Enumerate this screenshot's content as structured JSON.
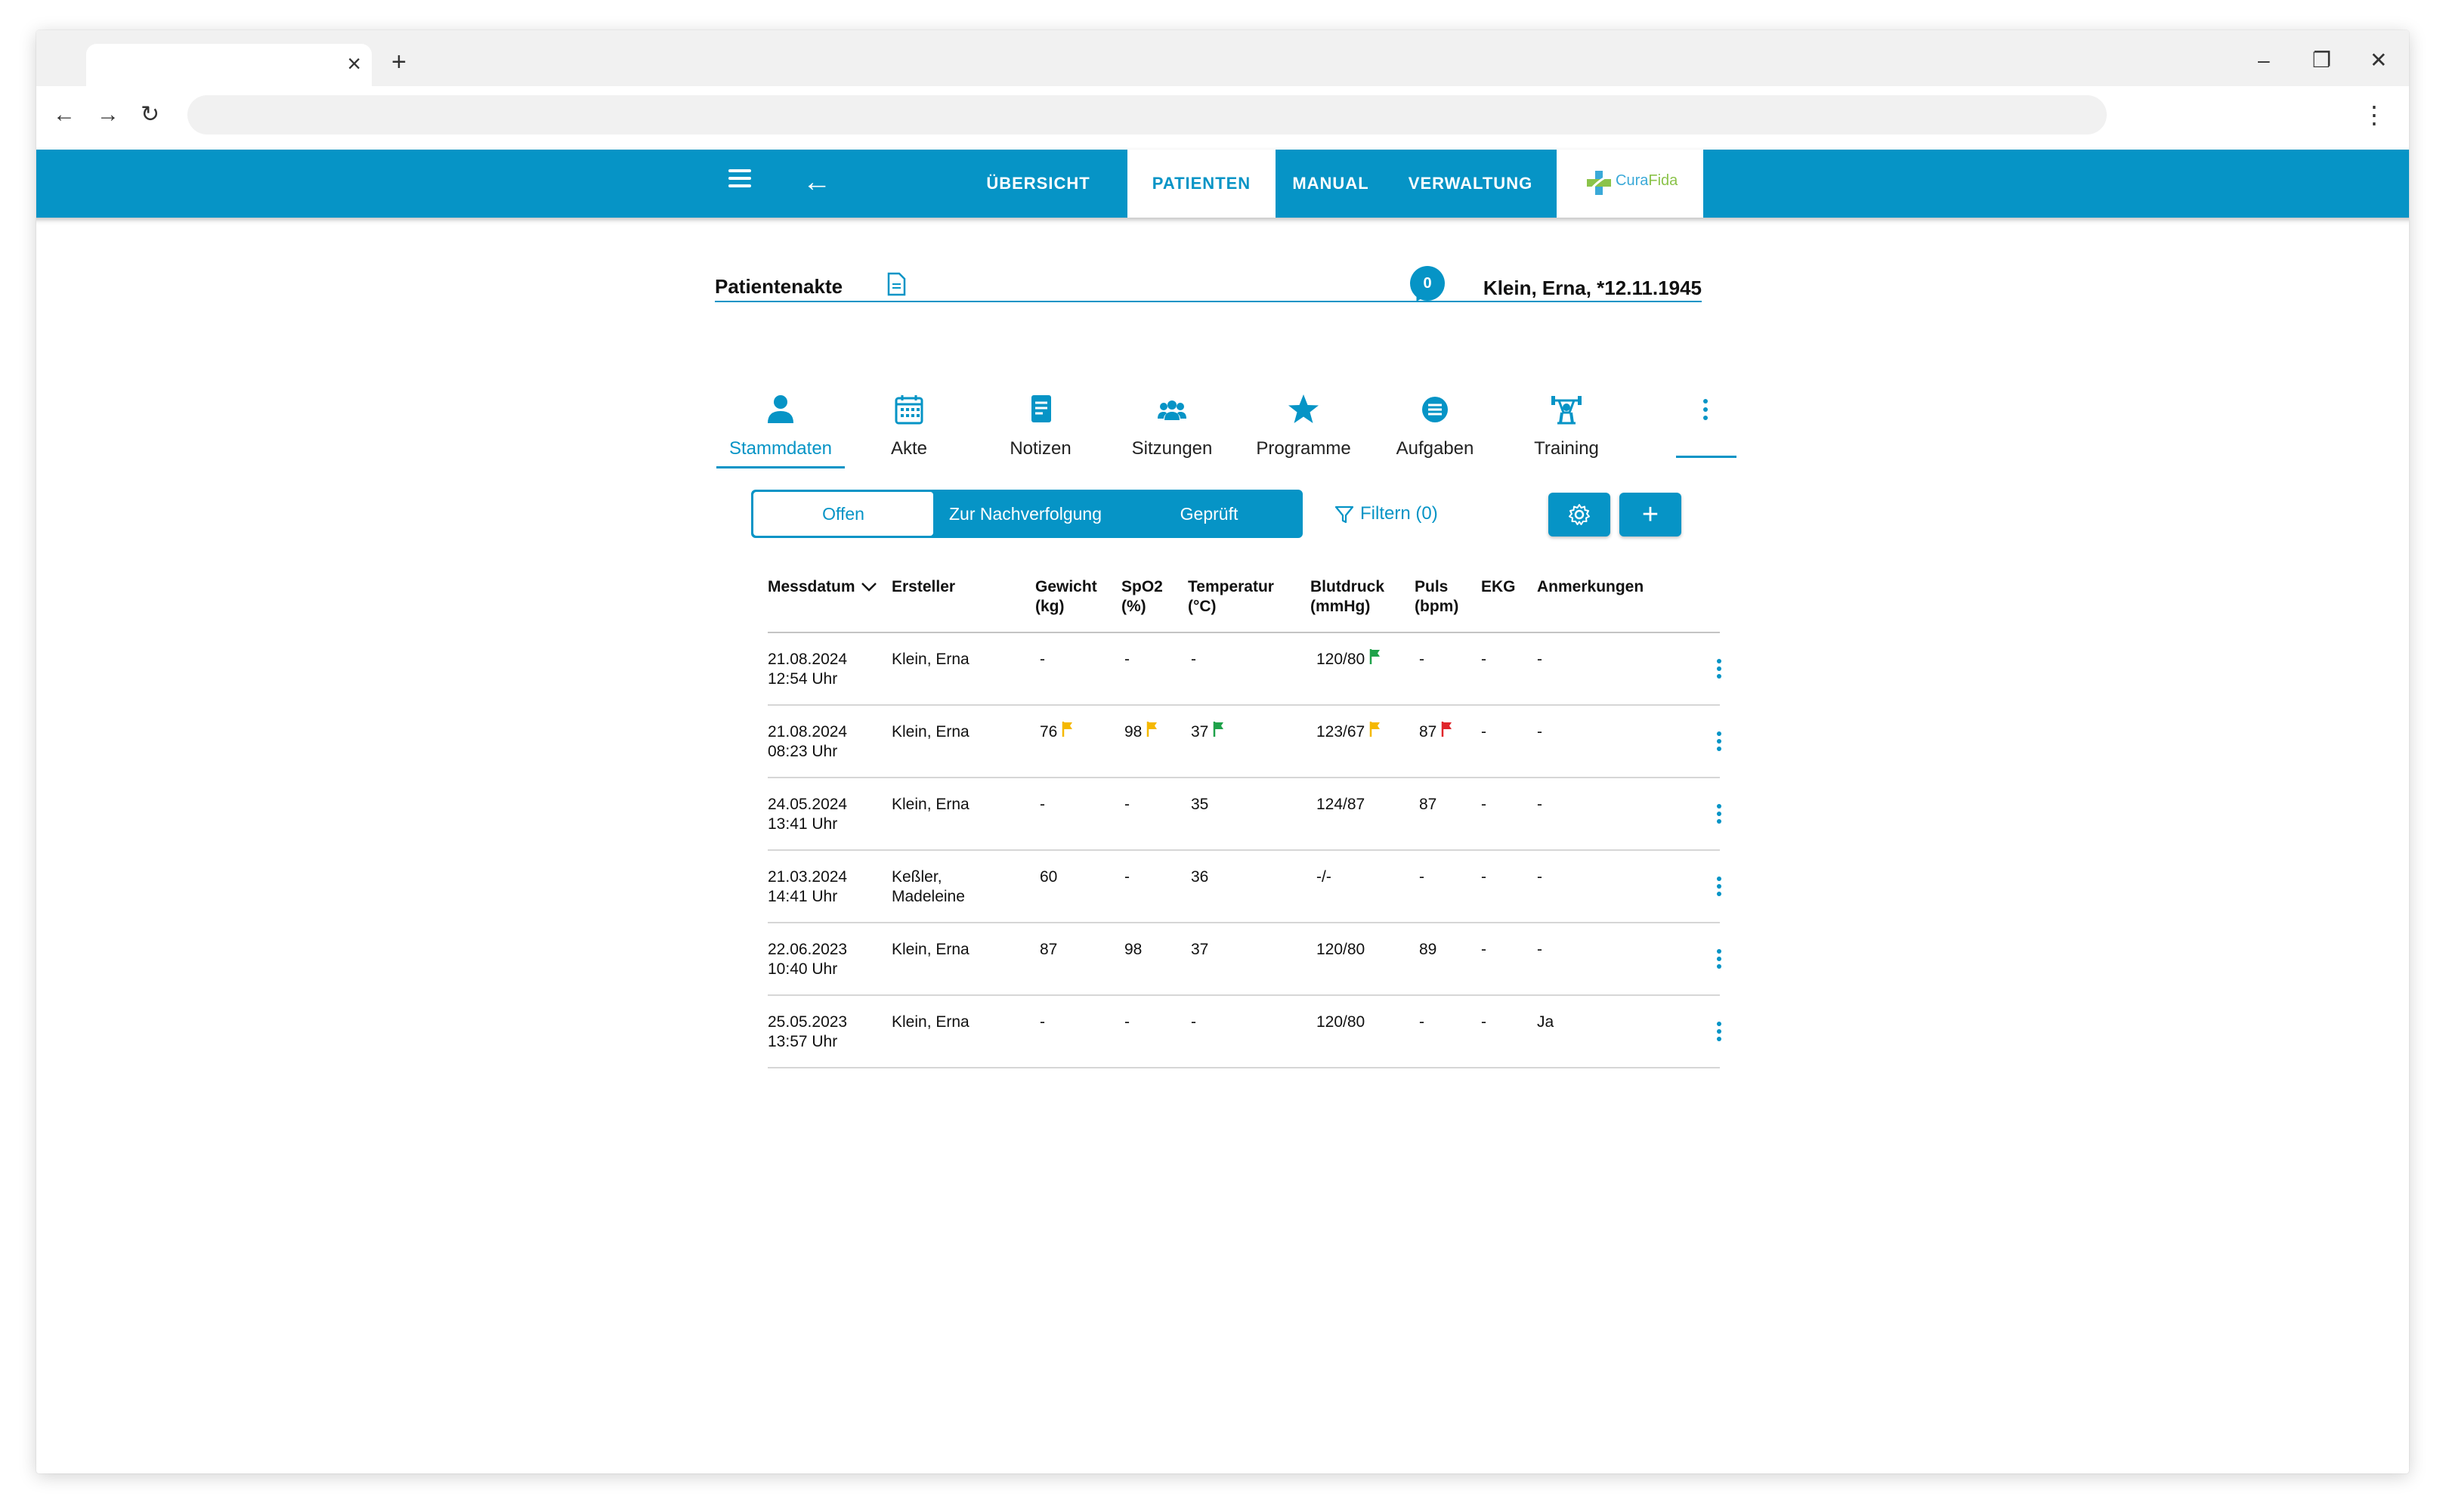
{
  "browser": {
    "tab_close": "×",
    "new_tab": "+",
    "minimize": "–",
    "restore": "❐",
    "close": "✕",
    "back": "←",
    "forward": "→",
    "reload": "↻",
    "menu": "⋮"
  },
  "header": {
    "nav": [
      "ÜBERSICHT",
      "PATIENTEN",
      "MANUAL",
      "VERWALTUNG"
    ],
    "active_nav": "PATIENTEN",
    "logo": {
      "part1": "Cura",
      "part2": "Fida"
    },
    "accent_color": "#0694c6"
  },
  "patient": {
    "title": "Patientenakte",
    "message_count": "0",
    "name": "Klein, Erna, *12.11.1945"
  },
  "section_tabs": {
    "items": [
      {
        "label": "Stammdaten",
        "icon": "person-icon"
      },
      {
        "label": "Akte",
        "icon": "calendar-icon"
      },
      {
        "label": "Notizen",
        "icon": "note-icon"
      },
      {
        "label": "Sitzungen",
        "icon": "group-icon"
      },
      {
        "label": "Programme",
        "icon": "star-icon"
      },
      {
        "label": "Aufgaben",
        "icon": "list-icon"
      },
      {
        "label": "Training",
        "icon": "training-icon"
      }
    ],
    "active": "Stammdaten"
  },
  "segments": {
    "items": [
      "Offen",
      "Zur Nachverfolgung",
      "Geprüft"
    ],
    "active": "Offen"
  },
  "filter": {
    "label": "Filtern (0)"
  },
  "table": {
    "columns": [
      {
        "line1": "Messdatum",
        "line2": ""
      },
      {
        "line1": "Ersteller",
        "line2": ""
      },
      {
        "line1": "Gewicht",
        "line2": "(kg)"
      },
      {
        "line1": "SpO2",
        "line2": "(%)"
      },
      {
        "line1": "Temperatur",
        "line2": "(°C)"
      },
      {
        "line1": "Blutdruck",
        "line2": "(mmHg)"
      },
      {
        "line1": "Puls",
        "line2": "(bpm)"
      },
      {
        "line1": "EKG",
        "line2": ""
      },
      {
        "line1": "Anmerkungen",
        "line2": ""
      }
    ],
    "sort_column": "Messdatum",
    "sort_direction": "descending",
    "flag_colors": {
      "yellow": "#f5b800",
      "green": "#1fa24a",
      "red": "#e0262b"
    },
    "rows": [
      {
        "date": "21.08.2024",
        "time": "12:54 Uhr",
        "author1": "Klein, Erna",
        "author2": "",
        "weight": "-",
        "spo2": "-",
        "temp": "-",
        "bp": "120/80",
        "pulse": "-",
        "ekg": "-",
        "note": "-",
        "flags": {
          "bp": "green"
        }
      },
      {
        "date": "21.08.2024",
        "time": "08:23 Uhr",
        "author1": "Klein, Erna",
        "author2": "",
        "weight": "76",
        "spo2": "98",
        "temp": "37",
        "bp": "123/67",
        "pulse": "87",
        "ekg": "-",
        "note": "-",
        "flags": {
          "weight": "yellow",
          "spo2": "yellow",
          "temp": "green",
          "bp": "yellow",
          "pulse": "red"
        }
      },
      {
        "date": "24.05.2024",
        "time": "13:41 Uhr",
        "author1": "Klein, Erna",
        "author2": "",
        "weight": "-",
        "spo2": "-",
        "temp": "35",
        "bp": "124/87",
        "pulse": "87",
        "ekg": "-",
        "note": "-",
        "flags": {}
      },
      {
        "date": "21.03.2024",
        "time": "14:41 Uhr",
        "author1": "Keßler,",
        "author2": "Madeleine",
        "weight": "60",
        "spo2": "-",
        "temp": "36",
        "bp": "-/-",
        "pulse": "-",
        "ekg": "-",
        "note": "-",
        "flags": {}
      },
      {
        "date": "22.06.2023",
        "time": "10:40 Uhr",
        "author1": "Klein, Erna",
        "author2": "",
        "weight": "87",
        "spo2": "98",
        "temp": "37",
        "bp": "120/80",
        "pulse": "89",
        "ekg": "-",
        "note": "-",
        "flags": {}
      },
      {
        "date": "25.05.2023",
        "time": "13:57 Uhr",
        "author1": "Klein, Erna",
        "author2": "",
        "weight": "-",
        "spo2": "-",
        "temp": "-",
        "bp": "120/80",
        "pulse": "-",
        "ekg": "-",
        "note": "Ja",
        "flags": {}
      }
    ]
  }
}
